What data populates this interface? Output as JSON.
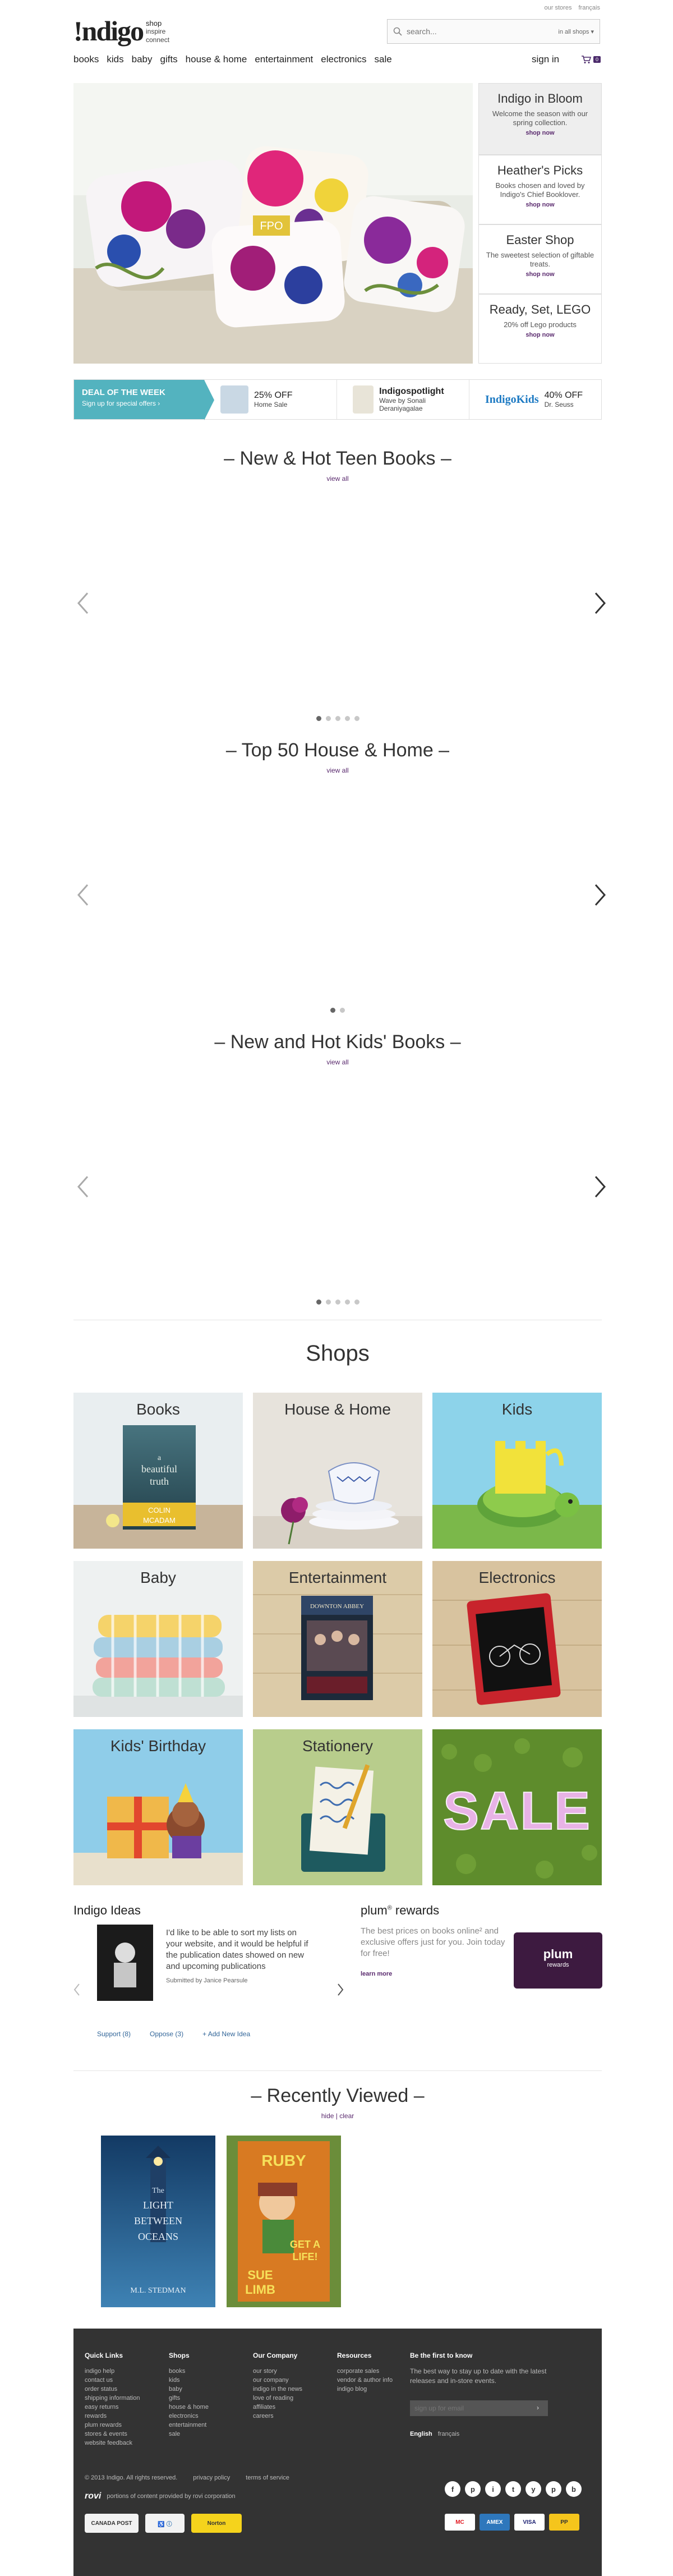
{
  "header": {
    "utility_links": [
      "our stores",
      "français"
    ],
    "logo": "!ndigo",
    "tagline": [
      "shop",
      "inspire",
      "connect"
    ],
    "search_placeholder": "search...",
    "search_scope": "in all shops ▾",
    "nav": [
      "books",
      "kids",
      "baby",
      "gifts",
      "house & home",
      "entertainment",
      "electronics",
      "sale"
    ],
    "signin": "sign in",
    "cart_count": "0"
  },
  "hero": {
    "badge": "FPO",
    "promos": [
      {
        "title": "Indigo in Bloom",
        "text": "Welcome the season with our spring collection.",
        "cta": "shop now"
      },
      {
        "title": "Heather's Picks",
        "text": "Books chosen and loved by Indigo's Chief Booklover.",
        "cta": "shop now"
      },
      {
        "title": "Easter Shop",
        "text": "The sweetest selection of giftable treats.",
        "cta": "shop now"
      },
      {
        "title": "Ready, Set, LEGO",
        "text": "20% off Lego products",
        "cta": "shop now"
      }
    ]
  },
  "deals": {
    "dotw_title": "DEAL OF THE WEEK",
    "dotw_sub": "Sign up for special offers ›",
    "items": [
      {
        "big": "25% OFF",
        "small": "Home Sale"
      },
      {
        "big": "Indigospotlight",
        "small": "Wave by Sonali Deraniyagalae"
      },
      {
        "big": "40% OFF",
        "small": "Dr. Seuss",
        "logo": "IndigoKids"
      }
    ]
  },
  "carousels": [
    {
      "title": "– New & Hot Teen Books –",
      "viewall": "view all",
      "dots": 5
    },
    {
      "title": "– Top 50 House & Home –",
      "viewall": "view all",
      "dots": 2
    },
    {
      "title": "– New and Hot Kids' Books –",
      "viewall": "view all",
      "dots": 5
    }
  ],
  "shops": {
    "title": "Shops",
    "tiles": [
      "Books",
      "House & Home",
      "Kids",
      "Baby",
      "Entertainment",
      "Electronics",
      "Kids' Birthday",
      "Stationery",
      "SALE"
    ],
    "book_cover": [
      "a",
      "beautiful",
      "truth",
      "COLIN",
      "MCADAM"
    ],
    "dvd_title": "DOWNTON ABBEY"
  },
  "ideas": {
    "title": "Indigo Ideas",
    "text": "I'd like to be able to sort my lists on your website, and it would be helpful if the publication dates showed on new and upcoming publications",
    "by": "Submitted by Janice Pearsule",
    "actions": [
      "Support (8)",
      "Oppose (3)",
      "+ Add New Idea"
    ]
  },
  "plum": {
    "title": "plum",
    "title_suffix": "rewards",
    "text": "The best prices on books online² and exclusive offers just for you. Join today for free!",
    "learn": "learn more",
    "card_title": "plum",
    "card_sub": "rewards"
  },
  "recent": {
    "title": "– Recently Viewed –",
    "hide": "hide",
    "clear": "clear",
    "book1": [
      "The",
      "LIGHT",
      "BETWEEN",
      "OCEANS",
      "M.L. STEDMAN"
    ],
    "book2": [
      "RUBY",
      "GET A",
      "LIFE!",
      "SUE",
      "LIMB"
    ]
  },
  "footer": {
    "cols": [
      {
        "head": "Quick Links",
        "items": [
          "indigo help",
          "contact us",
          "order status",
          "shipping information",
          "easy returns",
          "rewards",
          "plum rewards",
          "stores & events",
          "website feedback"
        ]
      },
      {
        "head": "Shops",
        "items": [
          "books",
          "kids",
          "baby",
          "gifts",
          "house & home",
          "electronics",
          "entertainment",
          "sale"
        ]
      },
      {
        "head": "Our Company",
        "items": [
          "our story",
          "our company",
          "indigo in the news",
          "love of reading",
          "affiliates",
          "careers"
        ]
      },
      {
        "head": "Resources",
        "items": [
          "corporate sales",
          "vendor & author info",
          "indigo blog"
        ]
      }
    ],
    "news_head": "Be the first to know",
    "news_text": "The best way to stay up to date with the latest releases and in-store events.",
    "news_placeholder": "sign up for email",
    "lang": [
      "English",
      "français"
    ],
    "copyright": "© 2013 Indigo. All rights reserved.",
    "privacy": "privacy policy",
    "terms": "terms of service",
    "rovi_logo": "rovi",
    "rovi_text": "portions of content provided by rovi corporation",
    "social": [
      "f",
      "p",
      "i",
      "t",
      "y",
      "p",
      "b"
    ],
    "payments": [
      "MC",
      "AMEX",
      "VISA",
      "PP"
    ],
    "trust": [
      "CANADA POST",
      "♿ ⓘ",
      "Norton"
    ]
  }
}
